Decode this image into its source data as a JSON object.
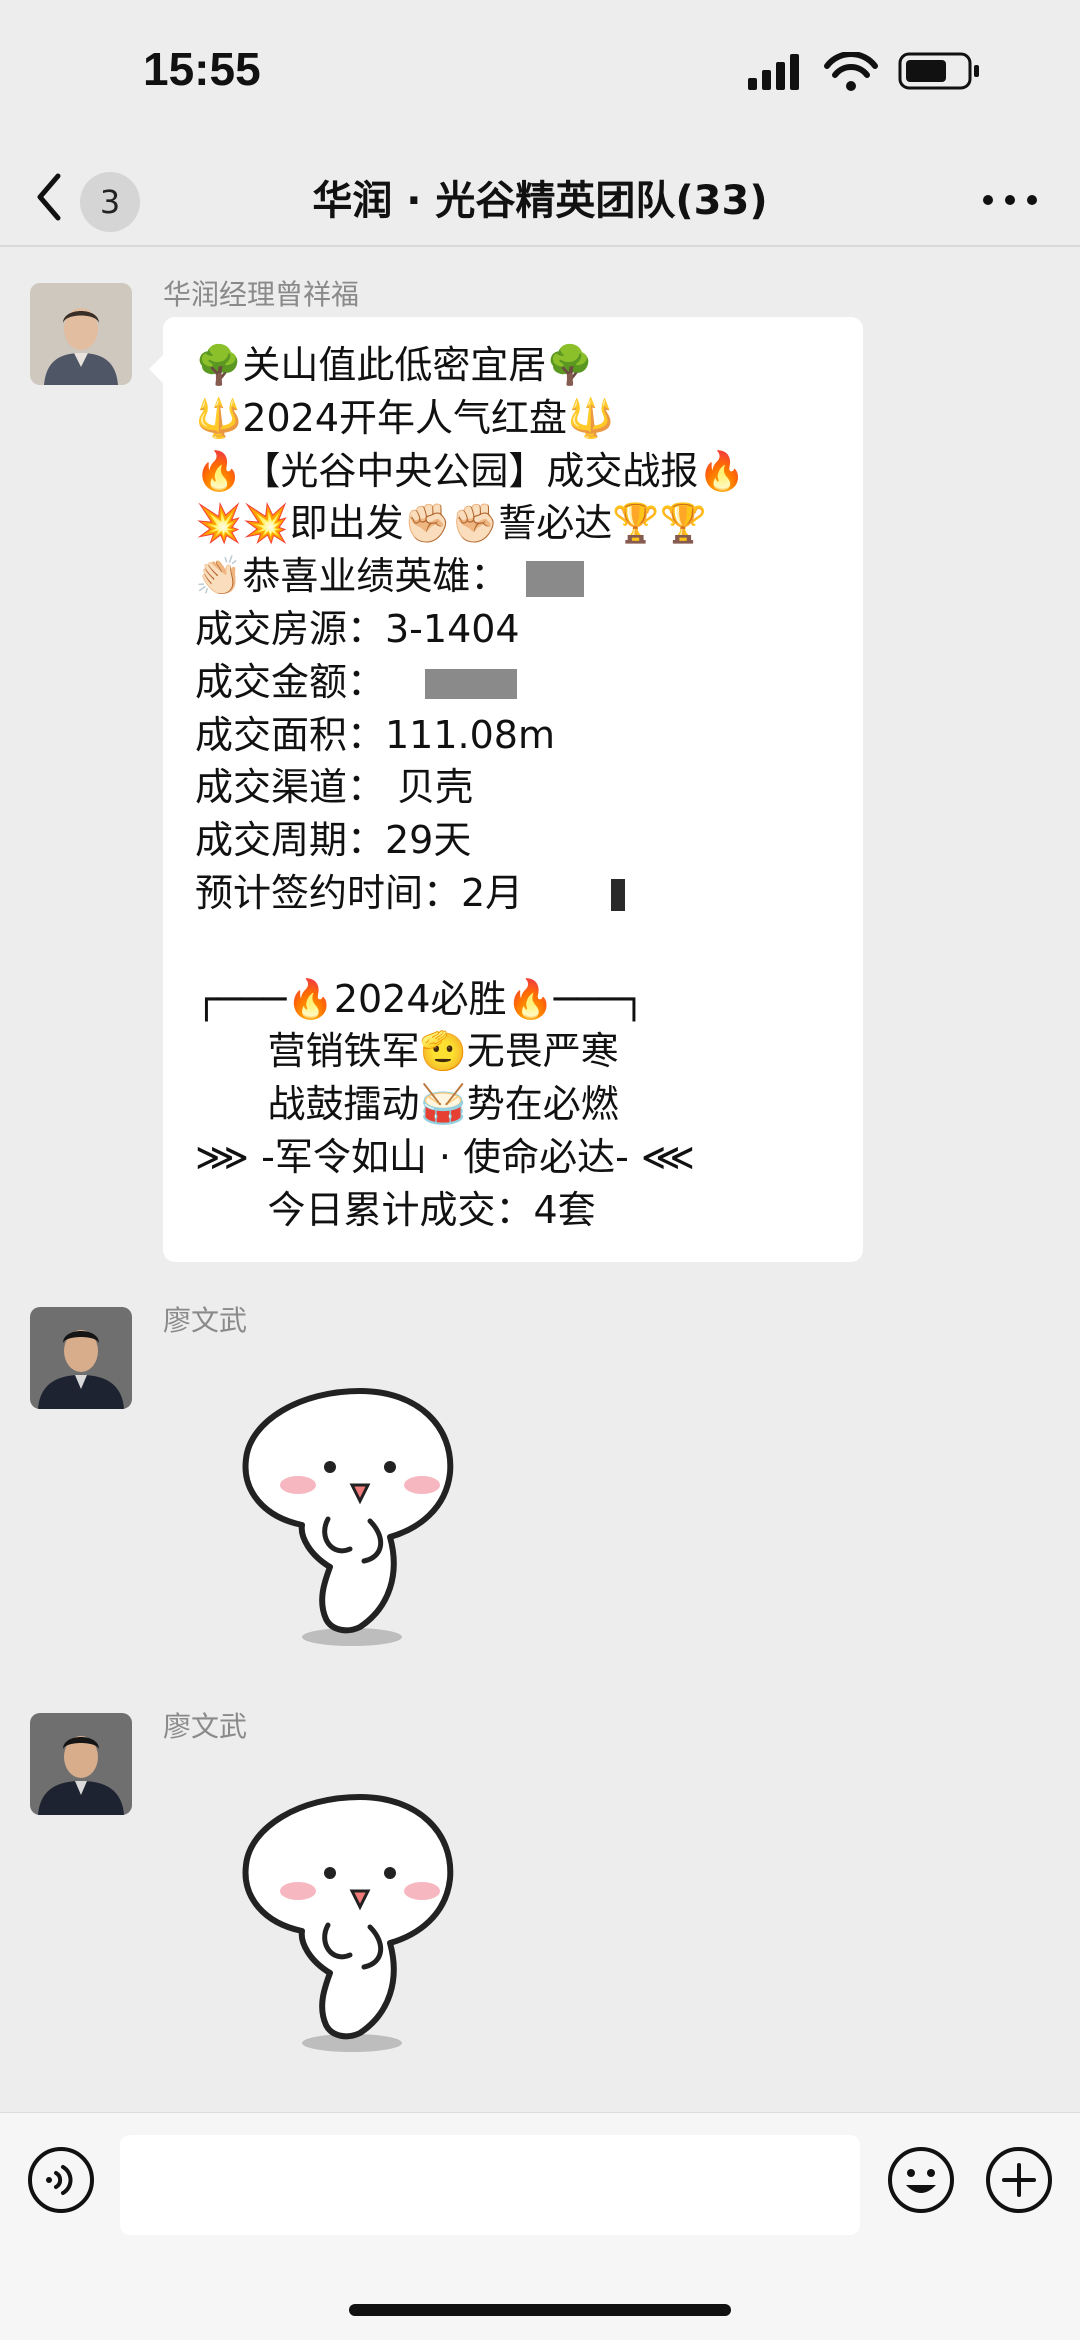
{
  "status_bar": {
    "time": "15:55",
    "icons": [
      "signal-icon",
      "wifi-icon",
      "battery-icon"
    ]
  },
  "nav": {
    "back_badge": "3",
    "title": "华润 · 光谷精英团队(33)"
  },
  "messages": [
    {
      "sender": "华润经理曾祥福",
      "type": "text",
      "lines": [
        "🌳关山值此低密宜居🌳",
        "🔱2024开年人气红盘🔱",
        "🔥【光谷中央公园】成交战报🔥",
        "💥💥即出发✊🏻✊🏻誓必达🏆🏆",
        "👏🏻恭喜业绩英雄：",
        "成交房源：3-1404",
        "成交金额：",
        "成交面积：111.08m",
        "成交渠道： 贝壳",
        "成交周期：29天",
        "预计签约时间：2月",
        "",
        "┌───🔥2024必胜🔥───┐",
        "      营销铁军🫡无畏严寒",
        "      战鼓擂动🥁势在必燃",
        "⋙ -军令如山 · 使命必达- ⋘",
        "      今日累计成交：4套"
      ]
    },
    {
      "sender": "廖文武",
      "type": "sticker",
      "sticker": "dancing-blob-sticker"
    },
    {
      "sender": "廖文武",
      "type": "sticker",
      "sticker": "dancing-blob-sticker"
    }
  ],
  "input_bar": {
    "placeholder": "",
    "icons": [
      "voice-icon",
      "emoji-icon",
      "plus-icon"
    ]
  },
  "colors": {
    "background": "#ededed",
    "bubble": "#ffffff",
    "sender_name": "#8a8a8a",
    "text": "#111111"
  }
}
